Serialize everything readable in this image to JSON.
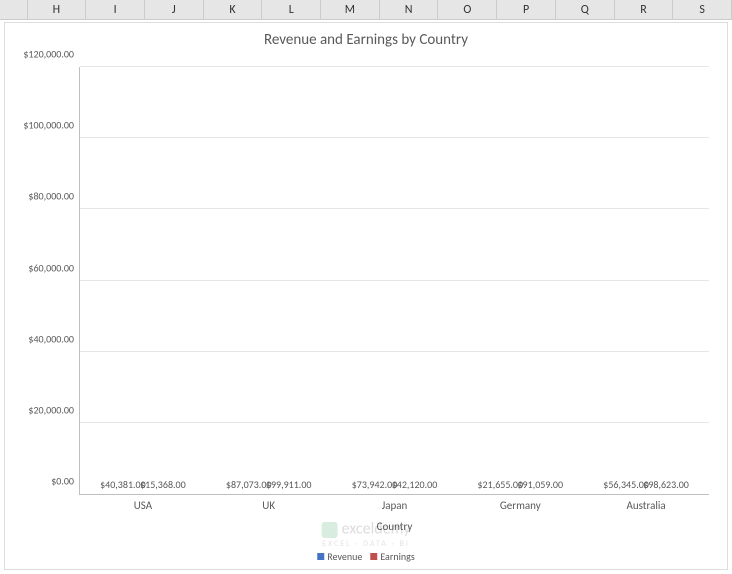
{
  "column_headers": [
    "H",
    "I",
    "J",
    "K",
    "L",
    "M",
    "N",
    "O",
    "P",
    "Q",
    "R",
    "S"
  ],
  "chart_data": {
    "type": "bar",
    "title": "Revenue and Earnings by Country",
    "xlabel": "Country",
    "ylabel": "",
    "categories": [
      "USA",
      "UK",
      "Japan",
      "Germany",
      "Australia"
    ],
    "series": [
      {
        "name": "Revenue",
        "values": [
          40381.0,
          87073.0,
          73942.0,
          21655.0,
          56345.0
        ],
        "color": "#4472C4"
      },
      {
        "name": "Earnings",
        "values": [
          15368.0,
          99911.0,
          42120.0,
          91059.0,
          98623.0
        ],
        "color": "#C0504D"
      }
    ],
    "ylim": [
      0,
      120000
    ],
    "y_ticks": [
      0,
      20000,
      40000,
      60000,
      80000,
      100000,
      120000
    ],
    "y_tick_labels": [
      "$0.00",
      "$20,000.00",
      "$40,000.00",
      "$60,000.00",
      "$80,000.00",
      "$100,000.00",
      "$120,000.00"
    ],
    "data_labels": [
      [
        "$40,381.00",
        "$87,073.00",
        "$73,942.00",
        "$21,655.00",
        "$56,345.00"
      ],
      [
        "$15,368.00",
        "$99,911.00",
        "$42,120.00",
        "$91,059.00",
        "$98,623.00"
      ]
    ],
    "legend": [
      "Revenue",
      "Earnings"
    ]
  },
  "watermark": {
    "text": "exceldemy",
    "subtitle": "EXCEL · DATA · BI"
  }
}
